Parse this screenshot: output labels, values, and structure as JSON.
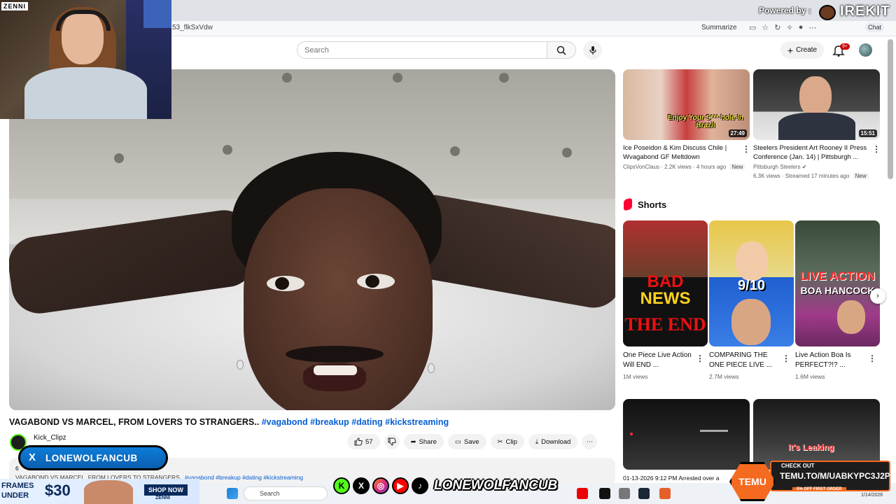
{
  "browser": {
    "url": "53_flkSxVdw",
    "summarize_label": "Summarize",
    "chat_label": "Chat",
    "powered_by": "Powered by :",
    "irekit": "IREKIT"
  },
  "header": {
    "search_placeholder": "Search",
    "create_label": "Create",
    "notif_count": "9+"
  },
  "webcam": {
    "corner_logo": "ZENNI"
  },
  "video": {
    "title": "VAGABOND VS MARCEL, FROM LOVERS TO STRANGERS..",
    "title_tags": "#vagabond #breakup #dating #kickstreaming",
    "channel": "Kick_Clipz",
    "likes": "57",
    "share_label": "Share",
    "save_label": "Save",
    "clip_label": "Clip",
    "download_label": "Download",
    "desc_prefix": "VAGABOND VS MARCEL, FROM LOVERS TO STRANGERS..",
    "desc_tags": "#vagabond #breakup #dating #kickstreaming",
    "desc_views_partial": "6"
  },
  "sidebar": {
    "videos": [
      {
        "title": "Ice Poseidon & Kim Discuss Chile | Wvagabond GF Meltdown",
        "channel": "ClipsVonClaus",
        "meta": "2.2K views · 4 hours ago",
        "badge": "New",
        "duration": "27:49",
        "overlay_text": "Enjoy Your S*** hole In Brazil"
      },
      {
        "title": "Steelers President Art Rooney II Press Conference (Jan. 14) | Pittsburgh ...",
        "channel": "Pittsburgh Steelers",
        "meta": "6.3K views · Streamed 17 minutes ago",
        "badge": "New",
        "duration": "15:51"
      }
    ],
    "shorts_heading": "Shorts",
    "shorts": [
      {
        "title": "One Piece Live Action Will END ...",
        "views": "1M views",
        "thumb_line1": "BAD",
        "thumb_line2": "NEWS",
        "thumb_line3": "THE END"
      },
      {
        "title": "COMPARING THE ONE PIECE LIVE ...",
        "views": "2.7M views",
        "thumb_text": "9/10"
      },
      {
        "title": "Live Action Boa Is PERFECT?!? ...",
        "views": "1.6M views",
        "thumb_line1": "LIVE ACTION",
        "thumb_line2": "BOA HANCOCK"
      }
    ],
    "bottom_caption": "01-13-2026 9:12 PM Arrested over a",
    "bottom_overlay": "It's Leaking"
  },
  "overlays": {
    "lonewolf_banner": "LONEWOLFANCUB",
    "social_handle": "LONEWOLFANCUB",
    "frames_line1": "FRAMES",
    "frames_line2": "UNDER",
    "frames_price": "$30",
    "frames_shop": "SHOP NOW",
    "frames_brand": "ZENNI",
    "temu_check": "CHECK OUT",
    "temu_url": "TEMU.TO/M/UABKYPC3J2P",
    "temu_discount": "5% OFF FIRST ORDER",
    "temu_logo": "TEMU"
  },
  "taskbar": {
    "search_label": "Search",
    "date": "1/14/2026"
  }
}
